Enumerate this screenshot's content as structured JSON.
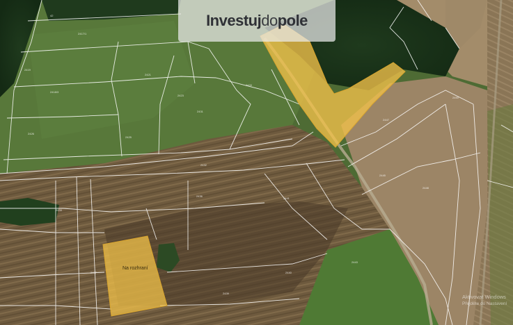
{
  "logo": {
    "part1": "Investuj",
    "part2": "do",
    "part3": "pole"
  },
  "highlighted_parcels": [
    {
      "label": "Na rozhraní"
    },
    {
      "label": ""
    }
  ],
  "watermark": {
    "line1": "Aktivovat Windows",
    "line2": "Přejděte do Nastavení"
  },
  "colors": {
    "parcel_fill": "#f2c24a",
    "parcel_stroke": "#d9a52e",
    "boundary_lines": "#ffffff"
  }
}
